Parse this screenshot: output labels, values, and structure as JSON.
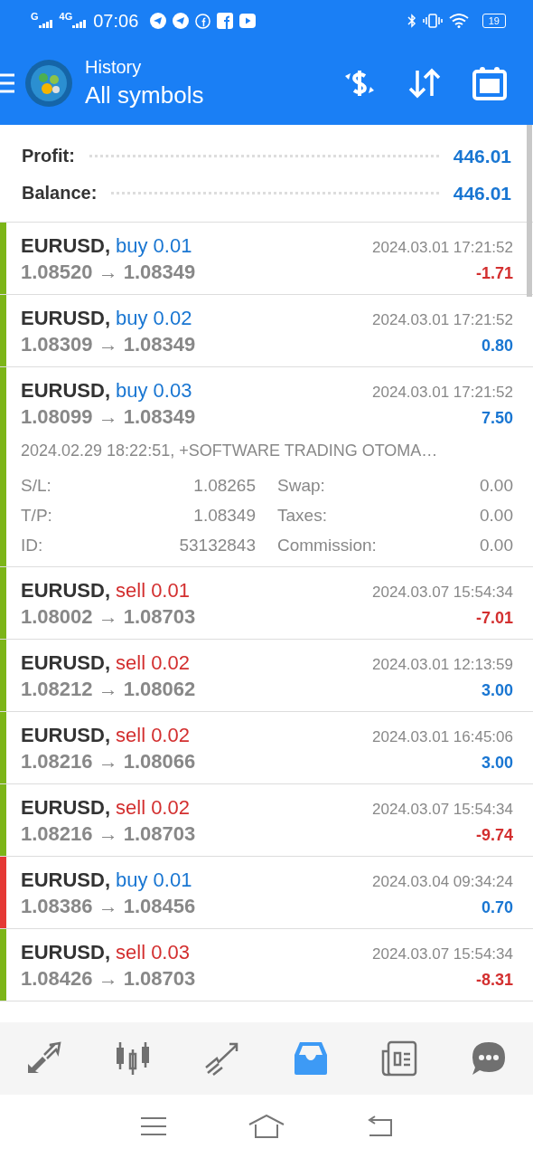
{
  "status_bar": {
    "network_1": "G",
    "network_2": "4G",
    "time": "07:06",
    "battery": "19"
  },
  "header": {
    "title": "History",
    "subtitle": "All symbols"
  },
  "summary": [
    {
      "label": "Profit:",
      "value": "446.01"
    },
    {
      "label": "Balance:",
      "value": "446.01"
    }
  ],
  "trades": [
    {
      "symbol": "EURUSD,",
      "order": {
        "text": "buy 0.01",
        "color": "#1976d2"
      },
      "prices": "1.08520 → 1.08349",
      "time": "2024.03.01 17:21:52",
      "profit": {
        "text": "-1.71",
        "color": "#d32f2f"
      },
      "color": "#7cb518"
    },
    {
      "symbol": "EURUSD,",
      "order": {
        "text": "buy 0.02",
        "color": "#1976d2"
      },
      "prices": "1.08309 → 1.08349",
      "time": "2024.03.01 17:21:52",
      "profit": {
        "text": "0.80",
        "color": "#1976d2"
      },
      "color": "#7cb518"
    },
    {
      "symbol": "EURUSD,",
      "order": {
        "text": "buy 0.03",
        "color": "#1976d2"
      },
      "prices": "1.08099 → 1.08349",
      "time": "2024.03.01 17:21:52",
      "profit": {
        "text": "7.50",
        "color": "#1976d2"
      },
      "color": "#7cb518",
      "details": {
        "comment": "2024.02.29 18:22:51, +SOFTWARE TRADING OTOMA…",
        "fields": [
          {
            "label": "S/L:",
            "value": "1.08265"
          },
          {
            "label": "Swap:",
            "value": "0.00"
          },
          {
            "label": "T/P:",
            "value": "1.08349"
          },
          {
            "label": "Taxes:",
            "value": "0.00"
          },
          {
            "label": "ID:",
            "value": "53132843"
          },
          {
            "label": "Commission:",
            "value": "0.00"
          }
        ]
      }
    },
    {
      "symbol": "EURUSD,",
      "order": {
        "text": "sell 0.01",
        "color": "#d32f2f"
      },
      "prices": "1.08002 → 1.08703",
      "time": "2024.03.07 15:54:34",
      "profit": {
        "text": "-7.01",
        "color": "#d32f2f"
      },
      "color": "#7cb518"
    },
    {
      "symbol": "EURUSD,",
      "order": {
        "text": "sell 0.02",
        "color": "#d32f2f"
      },
      "prices": "1.08212 → 1.08062",
      "time": "2024.03.01 12:13:59",
      "profit": {
        "text": "3.00",
        "color": "#1976d2"
      },
      "color": "#7cb518"
    },
    {
      "symbol": "EURUSD,",
      "order": {
        "text": "sell 0.02",
        "color": "#d32f2f"
      },
      "prices": "1.08216 → 1.08066",
      "time": "2024.03.01 16:45:06",
      "profit": {
        "text": "3.00",
        "color": "#1976d2"
      },
      "color": "#7cb518"
    },
    {
      "symbol": "EURUSD,",
      "order": {
        "text": "sell 0.02",
        "color": "#d32f2f"
      },
      "prices": "1.08216 → 1.08703",
      "time": "2024.03.07 15:54:34",
      "profit": {
        "text": "-9.74",
        "color": "#d32f2f"
      },
      "color": "#7cb518"
    },
    {
      "symbol": "EURUSD,",
      "order": {
        "text": "buy 0.01",
        "color": "#1976d2"
      },
      "prices": "1.08386 → 1.08456",
      "time": "2024.03.04 09:34:24",
      "profit": {
        "text": "0.70",
        "color": "#1976d2"
      },
      "color": "#e53935"
    },
    {
      "symbol": "EURUSD,",
      "order": {
        "text": "sell 0.03",
        "color": "#d32f2f"
      },
      "prices": "1.08426 → 1.08703",
      "time": "2024.03.07 15:54:34",
      "profit": {
        "text": "-8.31",
        "color": "#d32f2f"
      },
      "color": "#7cb518"
    }
  ],
  "bottom_nav": [
    {
      "kind": "quotes",
      "selected": false
    },
    {
      "kind": "chart",
      "selected": false
    },
    {
      "kind": "trade",
      "selected": false
    },
    {
      "kind": "history",
      "selected": true
    },
    {
      "kind": "news",
      "selected": false
    },
    {
      "kind": "chat",
      "selected": false
    }
  ]
}
